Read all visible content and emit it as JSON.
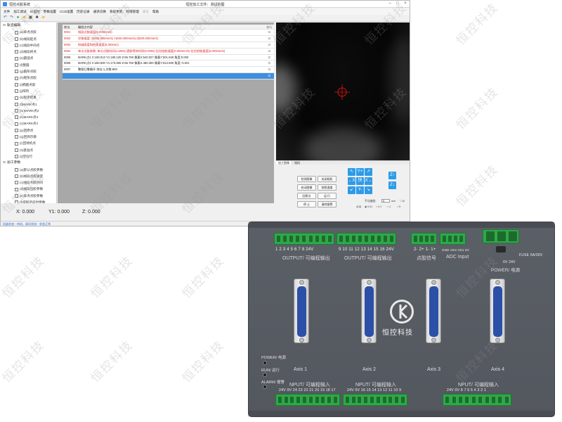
{
  "window": {
    "app_name": "恒控点胶系统",
    "doc_title": "恒控加工文件：测试的图",
    "controls": [
      "–",
      "□",
      "×"
    ]
  },
  "menu": [
    {
      "label": "文件",
      "enabled": true
    },
    {
      "label": "加工调试",
      "enabled": true
    },
    {
      "label": "IO监控",
      "enabled": true
    },
    {
      "label": "参数设置",
      "enabled": true
    },
    {
      "label": "CCD设置",
      "enabled": true
    },
    {
      "label": "历史记录",
      "enabled": true
    },
    {
      "label": "通讯切换",
      "enabled": true
    },
    {
      "label": "系统更新",
      "enabled": true
    },
    {
      "label": "权限管理",
      "enabled": true
    },
    {
      "label": "语言",
      "enabled": false
    },
    {
      "label": "帮助",
      "enabled": true
    }
  ],
  "toolbar_icons": [
    {
      "name": "undo-icon",
      "glyph": "↶",
      "color": "#2a6fd6"
    },
    {
      "name": "redo-icon",
      "glyph": "↷",
      "color": "#2a6fd6"
    },
    {
      "name": "new-file-icon",
      "glyph": "●",
      "color": "#2e9e3e"
    },
    {
      "name": "open-folder-icon",
      "glyph": "▰",
      "color": "#e0a020"
    },
    {
      "name": "save-icon",
      "glyph": "▣",
      "color": "#555555"
    },
    {
      "name": "lock-icon",
      "glyph": "■",
      "color": "#444444"
    },
    {
      "name": "folder-icon",
      "glyph": "▰",
      "color": "#e8b430"
    }
  ],
  "tree": [
    {
      "type": "group",
      "label": "轨迹编辑"
    },
    {
      "type": "item",
      "label": "(a)单点点胶"
    },
    {
      "type": "item",
      "label": "(b)线段起点"
    },
    {
      "type": "item",
      "label": "(c)线段中间点"
    },
    {
      "type": "item",
      "label": "(d)线段终点"
    },
    {
      "type": "item",
      "label": "(e)圆弧点"
    },
    {
      "type": "item",
      "label": "(f)整圆"
    },
    {
      "type": "item",
      "label": "(g)圆形点胶"
    },
    {
      "type": "item",
      "label": "(h)矩形点胶"
    },
    {
      "type": "item",
      "label": "(i)椭圆点胶"
    },
    {
      "type": "item",
      "label": "(j)阵列"
    },
    {
      "type": "item",
      "label": "(k)程序结束"
    },
    {
      "type": "item",
      "label": "(l)MARK点1"
    },
    {
      "type": "item",
      "label": "(m)MARK点2"
    },
    {
      "type": "item",
      "label": "(n)MARK点3"
    },
    {
      "type": "item",
      "label": "(o)MARK点4"
    },
    {
      "type": "item",
      "label": "(p)回原点"
    },
    {
      "type": "item",
      "label": "(q)回到示教"
    },
    {
      "type": "item",
      "label": "(r)回待机点"
    },
    {
      "type": "item",
      "label": "(s)基准点"
    },
    {
      "type": "item",
      "label": "(t)空位行"
    },
    {
      "type": "group",
      "label": "加工参数"
    },
    {
      "type": "item",
      "label": "(a)默认点胶参数"
    },
    {
      "type": "item",
      "label": "(b)线段点胶速度"
    },
    {
      "type": "item",
      "label": "(c)线段点胶时间"
    },
    {
      "type": "item",
      "label": "(d)线段出胶参数"
    },
    {
      "type": "item",
      "label": "(e)单点点胶参数"
    },
    {
      "type": "item",
      "label": "(f)提胶后延时参数"
    }
  ],
  "table": {
    "headers": {
      "addr": "地址",
      "content": "编程点内容",
      "exec": "执行"
    },
    "rows": [
      {
        "addr": "0001",
        "content": "线段点胶速度(5.000mm/s)",
        "exec": "☑",
        "highlight": "red"
      },
      {
        "addr": "0002",
        "content": "空移速度: X(600.000mm/s) Y(600.000mm/s) Z(500.000mm/s)",
        "exec": "☑",
        "highlight": "red"
      },
      {
        "addr": "0003",
        "content": "抬轴高度和抬高速度(5.000mm)",
        "exec": "☑",
        "highlight": "red"
      },
      {
        "addr": "0004",
        "content": "单点点胶参数: 单点点胶时间(1.500s) 提胶等待时间(0.000s) 拉拉抬胶速度(0.000mm/s) 拉拉抬胶速度(5.000mm/s)",
        "exec": "☑",
        "highlight": "red"
      },
      {
        "addr": "0005",
        "content": "MARK点1 X:150.013 Y1:180.120 Z:65.750 像素X:540.027 像素Y:501.628 角度:0.000",
        "exec": "☑",
        "highlight": ""
      },
      {
        "addr": "0006",
        "content": "MARK点2 X:260.600 Y1:173.900 Z:65.750 像素X:480.300 像素Y:512.500 角度:-0.021",
        "exec": "☑",
        "highlight": ""
      },
      {
        "addr": "0007",
        "content": "整版归零循环 地址:1,次数:800",
        "exec": "☑",
        "highlight": ""
      },
      {
        "addr": "",
        "content": "",
        "exec": "☑",
        "highlight": "selected"
      }
    ]
  },
  "camera_tabs": [
    {
      "label": "加工图像",
      "active": true
    },
    {
      "label": "相机",
      "active": false
    }
  ],
  "crosshair_color": "#e01010",
  "control_buttons": [
    {
      "label": "检测图像",
      "name": "detect-image-button"
    },
    {
      "label": "关闭相机",
      "name": "close-camera-button"
    },
    {
      "label": "启动图像",
      "name": "start-image-button"
    },
    {
      "label": "拍照速度",
      "name": "photo-speed-button"
    },
    {
      "label": "回原点",
      "name": "home-button"
    },
    {
      "label": "运 行",
      "name": "run-button"
    },
    {
      "label": "停 止",
      "name": "stop-button"
    },
    {
      "label": "清除报警",
      "name": "clear-alarm-button"
    }
  ],
  "jog": {
    "y_plus": "Y+",
    "y_minus": "Y-",
    "x_minus": "←X",
    "x_plus": "X→",
    "center": "快",
    "z_plus": "Z↑",
    "z_minus": "Z↓",
    "step_label": "手动速度:",
    "step_value": "5",
    "step_unit": "mm",
    "mode_label": "点动",
    "options": [
      "◉ 0.01",
      "○ 0.1",
      "○ 1",
      "○ 5"
    ],
    "check_label": "□ 10"
  },
  "coords": {
    "x": "X: 0.000",
    "y": "Y1: 0.000",
    "z": "Z: 0.000"
  },
  "status_bar": "机器状态：待机，调试状态：状态正常",
  "device": {
    "output1_numbers": "1   2   3   4   5   6   7   8  24V",
    "output1_label": "OUTPUT/ 可编程输出",
    "output2_numbers": "9  10  11  12  13  14  15  16  24V",
    "output2_label": "OUTPUT/ 可编程输出",
    "signal_numbers": "2-  2+  1-  1+",
    "signal_label": "点胶信号",
    "adc_numbers": "GND AD2 AD1  5V",
    "adc_label": "ADC Input",
    "fuse_label": "FUSE  5A/30V",
    "power_pins": "0V  24V",
    "power_label": "POWER/ 电源",
    "axes": [
      "Axis 1",
      "Axis 2",
      "Axis 3",
      "Axis 4"
    ],
    "led_power": "POWER/ 电源",
    "led_run": "RUN/ 运行",
    "led_alarm": "ALARM/ 报警",
    "input1_label": "NPUT/ 可编程输入",
    "input1_numbers": "24V 0V 24 23 22 21 20 19 18 17",
    "input2_label": "NPUT/ 可编程输入",
    "input2_numbers": "24V 0V 16 15 14 13 12 11 10  9",
    "input3_label": "NPUT/ 可编程输入",
    "input3_numbers": "24V 0V  8   7   6   5   4   3   2   1",
    "brand": "恒控科技"
  },
  "watermark": "恒控科技"
}
